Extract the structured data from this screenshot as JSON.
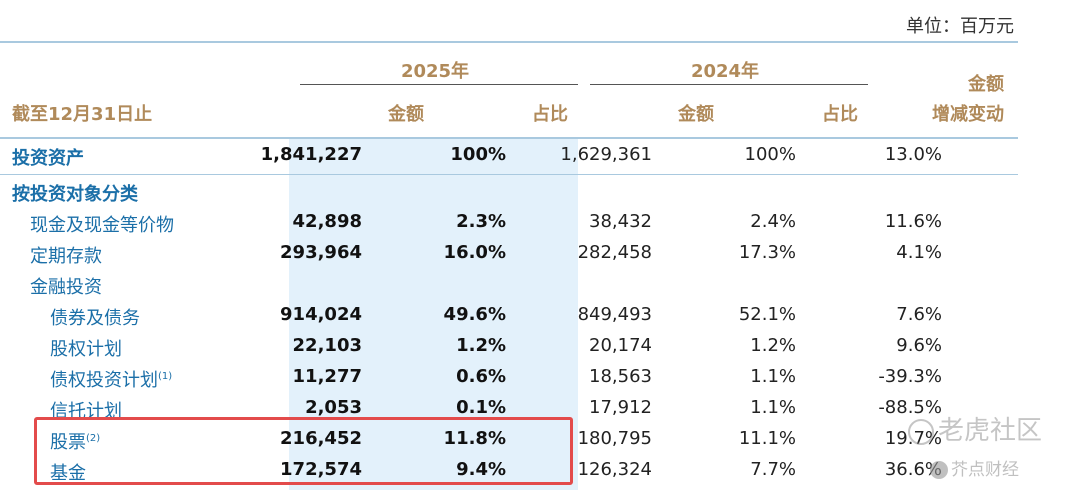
{
  "unit_label": "单位：百万元",
  "header": {
    "year_2025": "2025年",
    "year_2024": "2024年",
    "row_label": "截至12月31日止",
    "amount": "金额",
    "ratio": "占比",
    "change_line1": "金额",
    "change_line2": "增减变动"
  },
  "rows": [
    {
      "label": "投资资产",
      "v2025": "1,841,227",
      "p2025": "100%",
      "v2024": "1,629,361",
      "p2024": "100%",
      "chg": "13.0%"
    },
    {
      "label": "按投资对象分类"
    },
    {
      "label": "现金及现金等价物",
      "v2025": "42,898",
      "p2025": "2.3%",
      "v2024": "38,432",
      "p2024": "2.4%",
      "chg": "11.6%"
    },
    {
      "label": "定期存款",
      "v2025": "293,964",
      "p2025": "16.0%",
      "v2024": "282,458",
      "p2024": "17.3%",
      "chg": "4.1%"
    },
    {
      "label": "金融投资"
    },
    {
      "label": "债券及债务",
      "v2025": "914,024",
      "p2025": "49.6%",
      "v2024": "849,493",
      "p2024": "52.1%",
      "chg": "7.6%"
    },
    {
      "label": "股权计划",
      "v2025": "22,103",
      "p2025": "1.2%",
      "v2024": "20,174",
      "p2024": "1.2%",
      "chg": "9.6%"
    },
    {
      "label": "债权投资计划",
      "note": "(1)",
      "v2025": "11,277",
      "p2025": "0.6%",
      "v2024": "18,563",
      "p2024": "1.1%",
      "chg": "-39.3%"
    },
    {
      "label": "信托计划",
      "v2025": "2,053",
      "p2025": "0.1%",
      "v2024": "17,912",
      "p2024": "1.1%",
      "chg": "-88.5%"
    },
    {
      "label": "股票",
      "note": "(2)",
      "v2025": "216,452",
      "p2025": "11.8%",
      "v2024": "180,795",
      "p2024": "11.1%",
      "chg": "19.7%"
    },
    {
      "label": "基金",
      "v2025": "172,574",
      "p2025": "9.4%",
      "v2024": "126,324",
      "p2024": "7.7%",
      "chg": "36.6%"
    }
  ],
  "watermark": {
    "line1": "老虎社区",
    "line2": "芥点财经"
  },
  "colors": {
    "header_gold": "#b08a5a",
    "label_blue": "#1b6fa8",
    "highlight_fill": "#e3f1fb",
    "rule_blue": "#a9c9df",
    "box_red": "#e34b4b"
  }
}
